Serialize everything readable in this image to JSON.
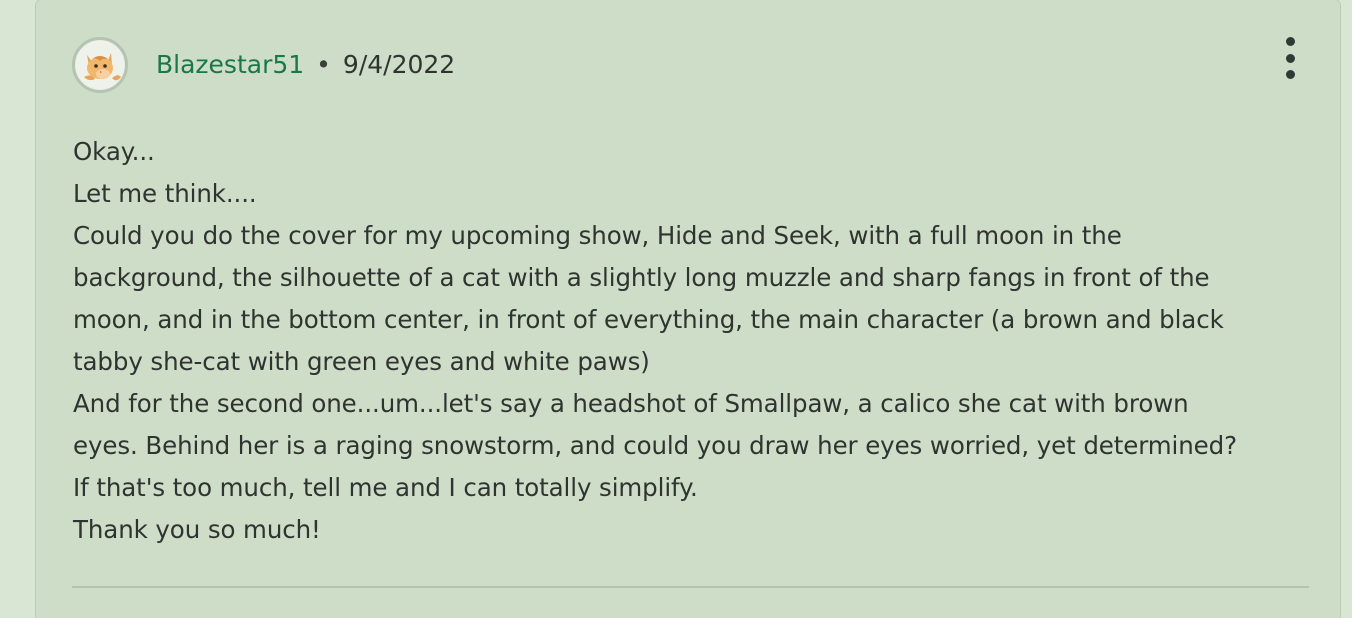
{
  "comment": {
    "author": "Blazestar51",
    "separator": "•",
    "date": "9/4/2022",
    "body_lines": [
      "Okay...",
      "Let me think....",
      "Could you do the cover for my upcoming show, Hide and Seek, with a full moon in the",
      "background, the silhouette of a cat with a slightly long muzzle and sharp fangs in front of the",
      "moon, and in the bottom center, in front of everything, the main character (a brown and black",
      "tabby she-cat with green eyes and white paws)",
      "And for the second one...um...let's say a headshot of Smallpaw, a calico she cat with brown",
      "eyes. Behind her is a raging snowstorm, and could you draw her eyes worried, yet determined?",
      "If that's too much, tell me and I can totally simplify.",
      "Thank you so much!"
    ],
    "avatar_icon": "orange-cat-avatar-icon",
    "menu_icon": "vertical-ellipsis-icon"
  },
  "colors": {
    "background": "#d8e6d3",
    "card": "#cdddc8",
    "username": "#197845",
    "text": "#2f3430",
    "divider": "#b3c3ae"
  }
}
